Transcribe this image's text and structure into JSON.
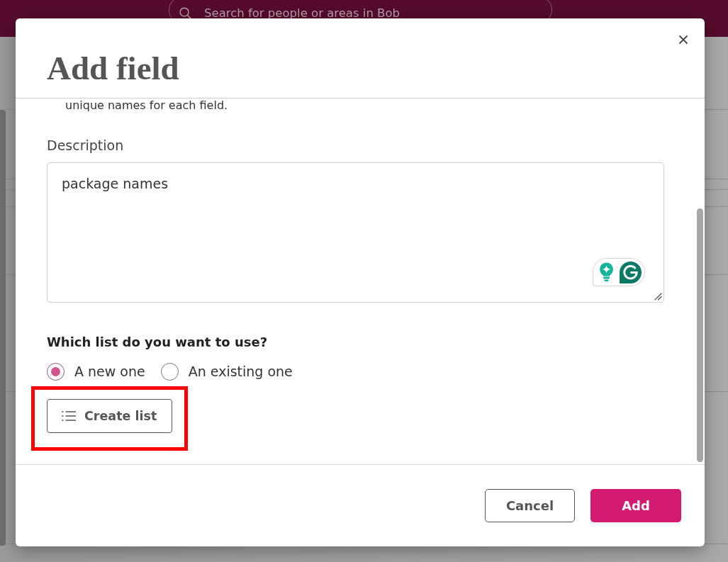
{
  "top_bar": {
    "search": {
      "placeholder": "Search for people or areas in Bob"
    }
  },
  "dialog": {
    "title": "Add field",
    "hint": "unique names for each field.",
    "description": {
      "label": "Description",
      "value": "package names"
    },
    "list_question": "Which list do you want to use?",
    "list_options": [
      {
        "label": "A new one",
        "selected": true
      },
      {
        "label": "An existing one",
        "selected": false
      }
    ],
    "create_list_button": "Create list",
    "buttons": [
      {
        "label": "Cancel",
        "kind": "secondary"
      },
      {
        "label": "Add",
        "kind": "primary"
      }
    ]
  }
}
